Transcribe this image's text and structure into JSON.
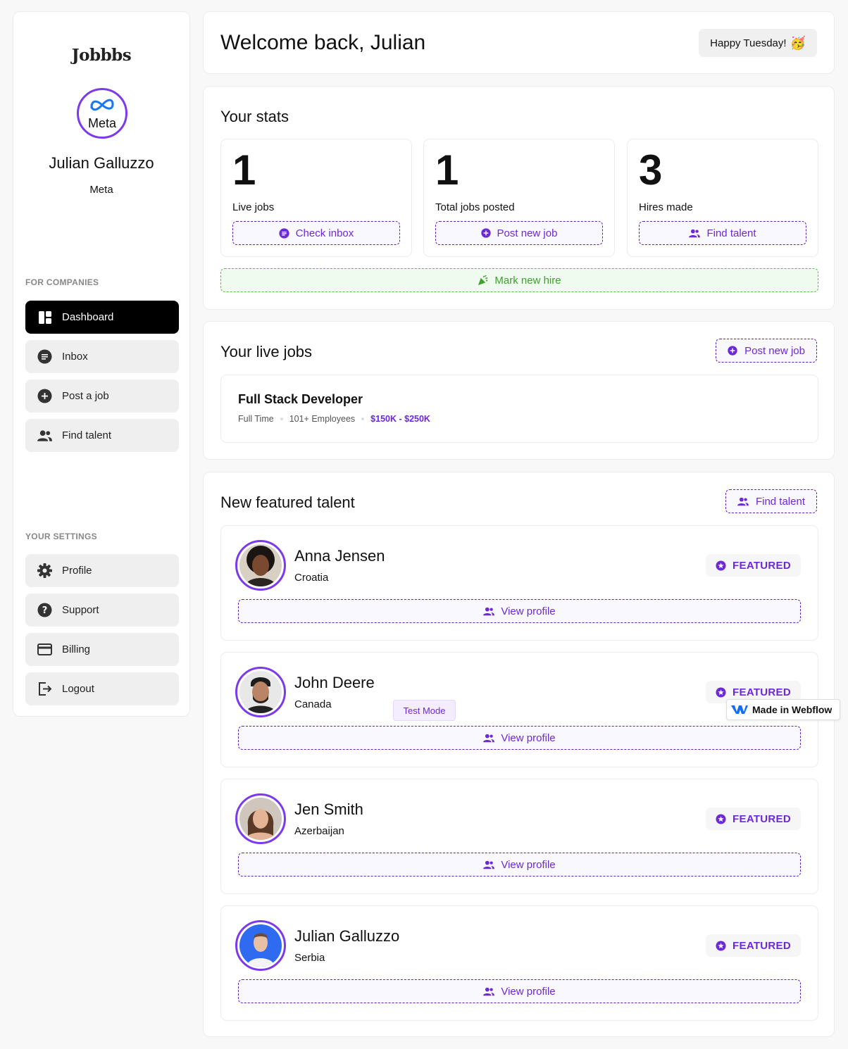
{
  "sidebar": {
    "logo": "Jobbbs",
    "company_logo_text": "Meta",
    "user_name": "Julian Galluzzo",
    "user_company": "Meta",
    "companies_title": "FOR COMPANIES",
    "company_items": [
      {
        "label": "Dashboard",
        "icon": "dashboard-icon",
        "active": true
      },
      {
        "label": "Inbox",
        "icon": "inbox-icon"
      },
      {
        "label": "Post a job",
        "icon": "plus-circle-icon"
      },
      {
        "label": "Find talent",
        "icon": "users-icon"
      }
    ],
    "settings_title": "YOUR SETTINGS",
    "settings_items": [
      {
        "label": "Profile",
        "icon": "gear-icon"
      },
      {
        "label": "Support",
        "icon": "help-icon"
      },
      {
        "label": "Billing",
        "icon": "credit-card-icon"
      },
      {
        "label": "Logout",
        "icon": "logout-icon"
      }
    ]
  },
  "header": {
    "welcome": "Welcome back, Julian",
    "greeting": "Happy Tuesday!",
    "greeting_emoji": "🥳"
  },
  "stats": {
    "title": "Your stats",
    "items": [
      {
        "value": "1",
        "label": "Live jobs",
        "button": "Check inbox",
        "icon": "inbox-icon"
      },
      {
        "value": "1",
        "label": "Total jobs posted",
        "button": "Post new job",
        "icon": "plus-circle-icon"
      },
      {
        "value": "3",
        "label": "Hires made",
        "button": "Find talent",
        "icon": "users-icon"
      }
    ],
    "mark_hire": "Mark new hire"
  },
  "jobs": {
    "title": "Your live jobs",
    "post_button": "Post new job",
    "items": [
      {
        "title": "Full Stack Developer",
        "type": "Full Time",
        "size": "101+ Employees",
        "salary": "$150K - $250K"
      }
    ]
  },
  "talent": {
    "title": "New featured talent",
    "find_button": "Find talent",
    "badge": "FEATURED",
    "view_button": "View profile",
    "items": [
      {
        "name": "Anna Jensen",
        "location": "Croatia"
      },
      {
        "name": "John Deere",
        "location": "Canada"
      },
      {
        "name": "Jen Smith",
        "location": "Azerbaijan"
      },
      {
        "name": "Julian Galluzzo",
        "location": "Serbia"
      }
    ]
  },
  "overlays": {
    "test_mode": "Test Mode",
    "webflow_badge": "Made in Webflow"
  },
  "colors": {
    "accent": "#6d28d9",
    "success": "#3fa02f",
    "nav_active": "#000000"
  }
}
